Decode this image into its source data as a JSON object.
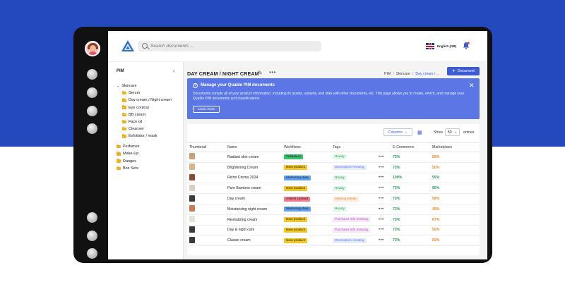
{
  "colors": {
    "backdrop_top": "#2449be",
    "accent": "#3b5bd9",
    "banner": "#5b77e6",
    "folder": "#f2b01e"
  },
  "header": {
    "search_placeholder": "Search documents ...",
    "language": "English (GB)"
  },
  "sidebar": {
    "title": "PIM",
    "collapse_icon": "chevron-left-icon",
    "tree": [
      {
        "label": "Skincare",
        "level": 0,
        "expanded": true
      },
      {
        "label": "Serum",
        "level": 1
      },
      {
        "label": "Day cream / Night cream",
        "level": 1
      },
      {
        "label": "Eye contour",
        "level": 1
      },
      {
        "label": "BB cream",
        "level": 1
      },
      {
        "label": "Face oil",
        "level": 1
      },
      {
        "label": "Cleanser",
        "level": 1
      },
      {
        "label": "Exfoliator / mask",
        "level": 1
      },
      {
        "label": "Perfumes",
        "level": 0
      },
      {
        "label": "Make-Up",
        "level": 0
      },
      {
        "label": "Ranges",
        "level": 0
      },
      {
        "label": "Box Sets",
        "level": 0
      }
    ]
  },
  "page": {
    "title": "DAY CREAM / NIGHT CREAM",
    "breadcrumb": [
      "PIM",
      "Skincare",
      "Day cream / ..."
    ],
    "new_doc_label": "Document"
  },
  "banner": {
    "title": "Manage your Quable PIM documents",
    "text": "Documents contain all of your product information, including its assets, variants, and links with other documents, etc. This page allows you to create, enrich, and manage your Quable PIM documents and classifications.",
    "button": "Learn more"
  },
  "table": {
    "columns_button": "Columns",
    "show_label": "Show",
    "page_size": "50",
    "entries_label": "entries",
    "headers": [
      "Thumbnail",
      "Name",
      "Workflows",
      "Tags",
      "",
      "E-Commerce",
      "Marketplace"
    ],
    "rows": [
      {
        "thumb": "#c9a27a",
        "name": "Radiant skin cream",
        "workflow": "Validation",
        "wf_color": "#36c26b",
        "tag": "Ready",
        "tag_bg": "#e3f7ea",
        "tag_fg": "#2a9d5c",
        "ecom": "73%",
        "market": "58%",
        "m_class": "pct-o"
      },
      {
        "thumb": "#d9b48a",
        "name": "Brightening Cream",
        "workflow": "New product",
        "wf_color": "#f4c724",
        "tag": "Description missing",
        "tag_bg": "#e7ecfb",
        "tag_fg": "#5b77e6",
        "ecom": "73%",
        "market": "50%",
        "m_class": "pct-o"
      },
      {
        "thumb": "#8a4a2e",
        "name": "Riche Crema 2024",
        "workflow": "Marketing data",
        "wf_color": "#5fa2ee",
        "tag": "Ready",
        "tag_bg": "#e3f7ea",
        "tag_fg": "#2a9d5c",
        "ecom": "100%",
        "market": "95%",
        "m_class": "pct-g"
      },
      {
        "thumb": "#d8d0c4",
        "name": "Pure Bamboo cream",
        "workflow": "New product",
        "wf_color": "#f4c724",
        "tag": "Ready",
        "tag_bg": "#e3f7ea",
        "tag_fg": "#2a9d5c",
        "ecom": "73%",
        "market": "95%",
        "m_class": "pct-g"
      },
      {
        "thumb": "#3a3a3a",
        "name": "Day cream",
        "workflow": "Assets Upload",
        "wf_color": "#f27a8c",
        "tag": "Missing Media",
        "tag_bg": "#fdece0",
        "tag_fg": "#e5893c",
        "ecom": "73%",
        "market": "58%",
        "m_class": "pct-o"
      },
      {
        "thumb": "#c97a5a",
        "name": "Moisturizing night cream",
        "workflow": "Marketing data",
        "wf_color": "#5fa2ee",
        "tag": "Ready",
        "tag_bg": "#e3f7ea",
        "tag_fg": "#2a9d5c",
        "ecom": "73%",
        "market": "48%",
        "m_class": "pct-o"
      },
      {
        "thumb": "#e8e2dc",
        "name": "Revitalizing cream",
        "workflow": "New product",
        "wf_color": "#f4c724",
        "tag": "Purchase info missing",
        "tag_bg": "#f6e6f7",
        "tag_fg": "#b05cc0",
        "ecom": "73%",
        "market": "67%",
        "m_class": "pct-o"
      },
      {
        "thumb": "#3a3a3a",
        "name": "Day & night care",
        "workflow": "New product",
        "wf_color": "#f4c724",
        "tag": "Purchase info missing",
        "tag_bg": "#f6e6f7",
        "tag_fg": "#b05cc0",
        "ecom": "73%",
        "market": "50%",
        "m_class": "pct-o"
      },
      {
        "thumb": "#3a3a3a",
        "name": "Classic cream",
        "workflow": "New product",
        "wf_color": "#f4c724",
        "tag": "Description missing",
        "tag_bg": "#e7ecfb",
        "tag_fg": "#5b77e6",
        "ecom": "73%",
        "market": "50%",
        "m_class": "pct-o"
      }
    ]
  }
}
